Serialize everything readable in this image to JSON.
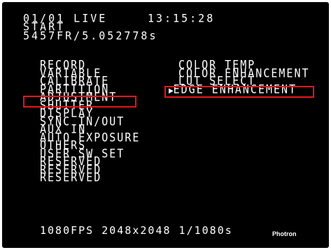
{
  "header": {
    "line1_left": "01/01 LIVE",
    "line1_time": "13:15:28",
    "line2": "START",
    "line3": "5457FR/5.052778s"
  },
  "menu_left": [
    "RECORD",
    "VARIABLE",
    "CALIBRATE",
    "PARTITION",
    "ADJUSTMENT",
    "SHUTTER",
    "DISPLAY",
    "SYNC IN/OUT",
    "AUX IN",
    "AUTO EXPOSURE",
    "OTHERS",
    "USER SW SET",
    "RESERVED",
    "RESERVED",
    "RESERVED"
  ],
  "menu_right": [
    "COLOR TEMP",
    "COLOR ENHANCEMENT",
    "LUT SELECT",
    "EDGE ENHANCEMENT"
  ],
  "cursor_glyph": "▶",
  "footer": {
    "status": "1080FPS 2048x2048 1/1080s",
    "brand": "Photron"
  },
  "colors": {
    "background": "#000000",
    "text": "#ffffff",
    "highlight": "#e8141b"
  }
}
